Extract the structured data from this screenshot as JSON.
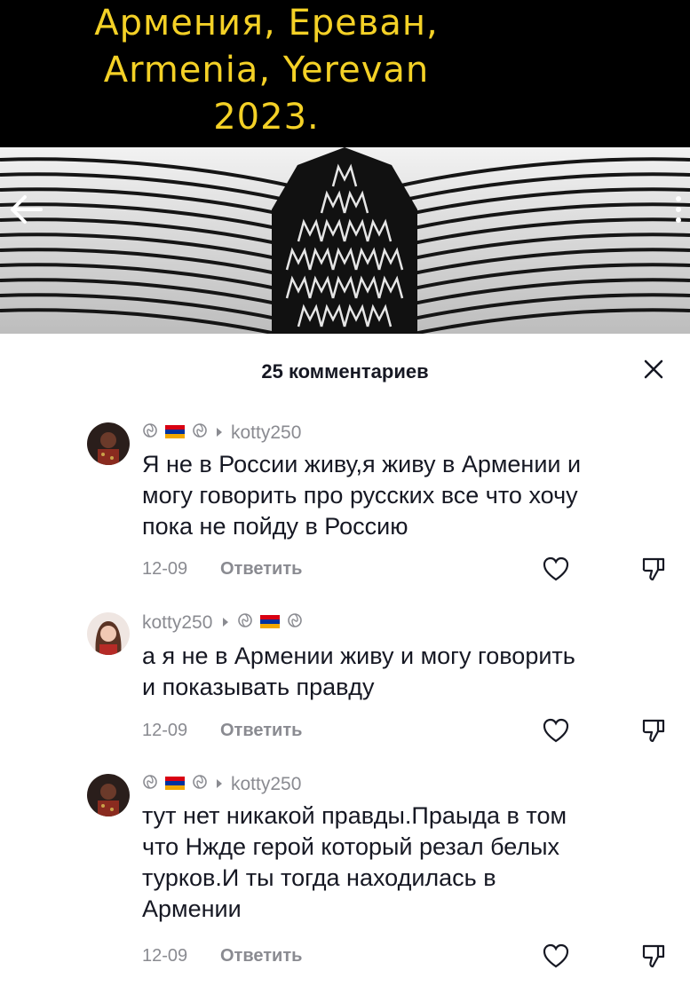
{
  "video": {
    "title_lines": [
      "Армения, Ереван,",
      "Armenia, Yerevan",
      "2023."
    ],
    "title_color": "#f4d126"
  },
  "comments_header": {
    "count_label": "25 комментариев"
  },
  "comments": [
    {
      "author": "kotty250",
      "author_first": false,
      "text_lines": [
        "Я не в России живу,я живу в Армении и",
        "могу говорить про русских все что хочу",
        "пока не пойду в Россию"
      ],
      "date": "12-09",
      "reply_label": "Ответить"
    },
    {
      "author": "kotty250",
      "author_first": true,
      "text_lines": [
        "а я не в Армении живу и могу говорить",
        "и показывать правду"
      ],
      "date": "12-09",
      "reply_label": "Ответить"
    },
    {
      "author": "kotty250",
      "author_first": false,
      "text_lines": [
        "тут нет никакой правды.Праыда в том",
        "что Нжде герой который резал белых",
        "турков.И ты тогда находилась в",
        "Армении"
      ],
      "date": "12-09",
      "reply_label": "Ответить"
    }
  ],
  "colors": {
    "muted": "#8a8b91",
    "text": "#161823",
    "flag": [
      "#d90012",
      "#0033a0",
      "#f2a800"
    ]
  }
}
